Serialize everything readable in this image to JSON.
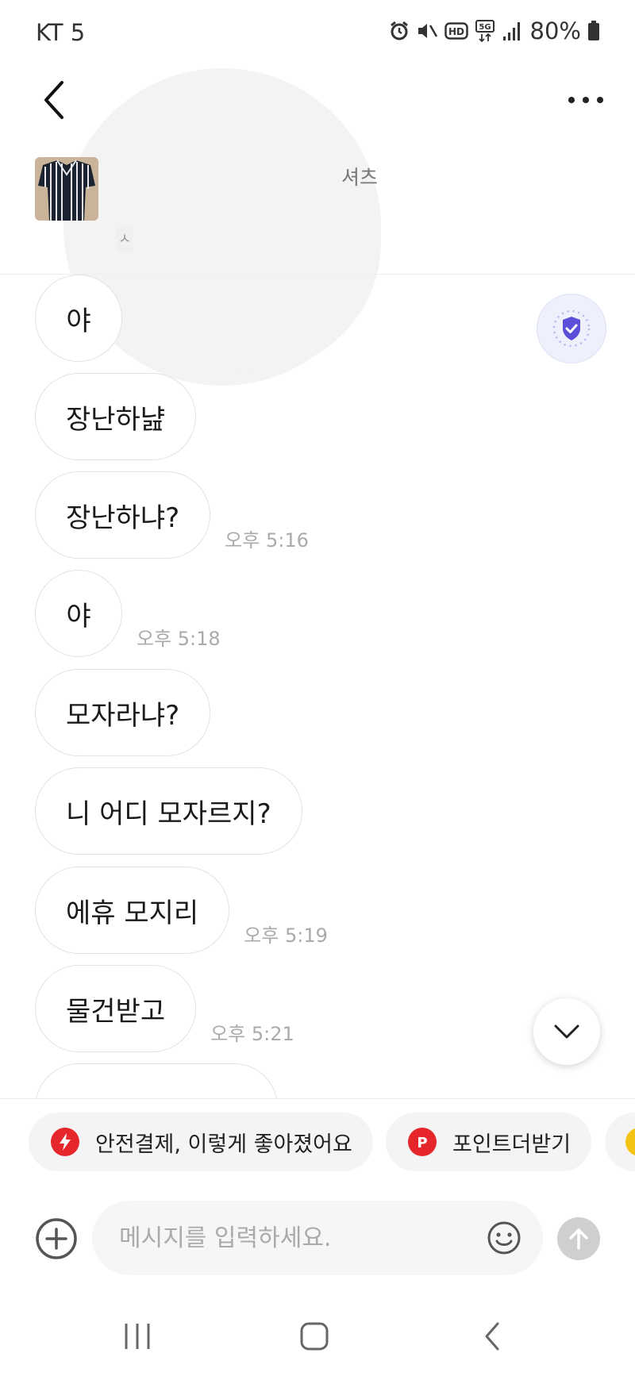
{
  "status_bar": {
    "carrier": "KT 5",
    "battery": "80%",
    "icons": [
      "alarm-icon",
      "mute-icon",
      "hd-icon",
      "5g-icon",
      "signal-icon",
      "battery-icon"
    ]
  },
  "header": {
    "back_icon": "chevron-left-icon",
    "more_icon": "more-dots-icon",
    "product_title_partial": "셔츠",
    "product_tag": "ㅅ"
  },
  "messages": [
    {
      "text": "야",
      "time": ""
    },
    {
      "text": "장난하냞",
      "time": ""
    },
    {
      "text": "장난하냐?",
      "time": "오후 5:16"
    },
    {
      "text": "야",
      "time": "오후 5:18"
    },
    {
      "text": "모자라냐?",
      "time": ""
    },
    {
      "text": "니 어디 모자르지?",
      "time": ""
    },
    {
      "text": "에휴 모지리",
      "time": "오후 5:19"
    },
    {
      "text": "물건받고",
      "time": "오후 5:21"
    }
  ],
  "chips": [
    {
      "label": "안전결제, 이렇게 좋아졌어요",
      "icon": "lightning-icon",
      "color": "#e5262a"
    },
    {
      "label": "포인트더받기",
      "icon": "point-icon",
      "color": "#e5262a"
    },
    {
      "label": "",
      "icon": "coin-icon",
      "color": "#f3c316"
    }
  ],
  "input": {
    "placeholder": "메시지를 입력하세요."
  },
  "colors": {
    "accent_purple": "#5b4fd9",
    "brand_red": "#e5262a"
  }
}
